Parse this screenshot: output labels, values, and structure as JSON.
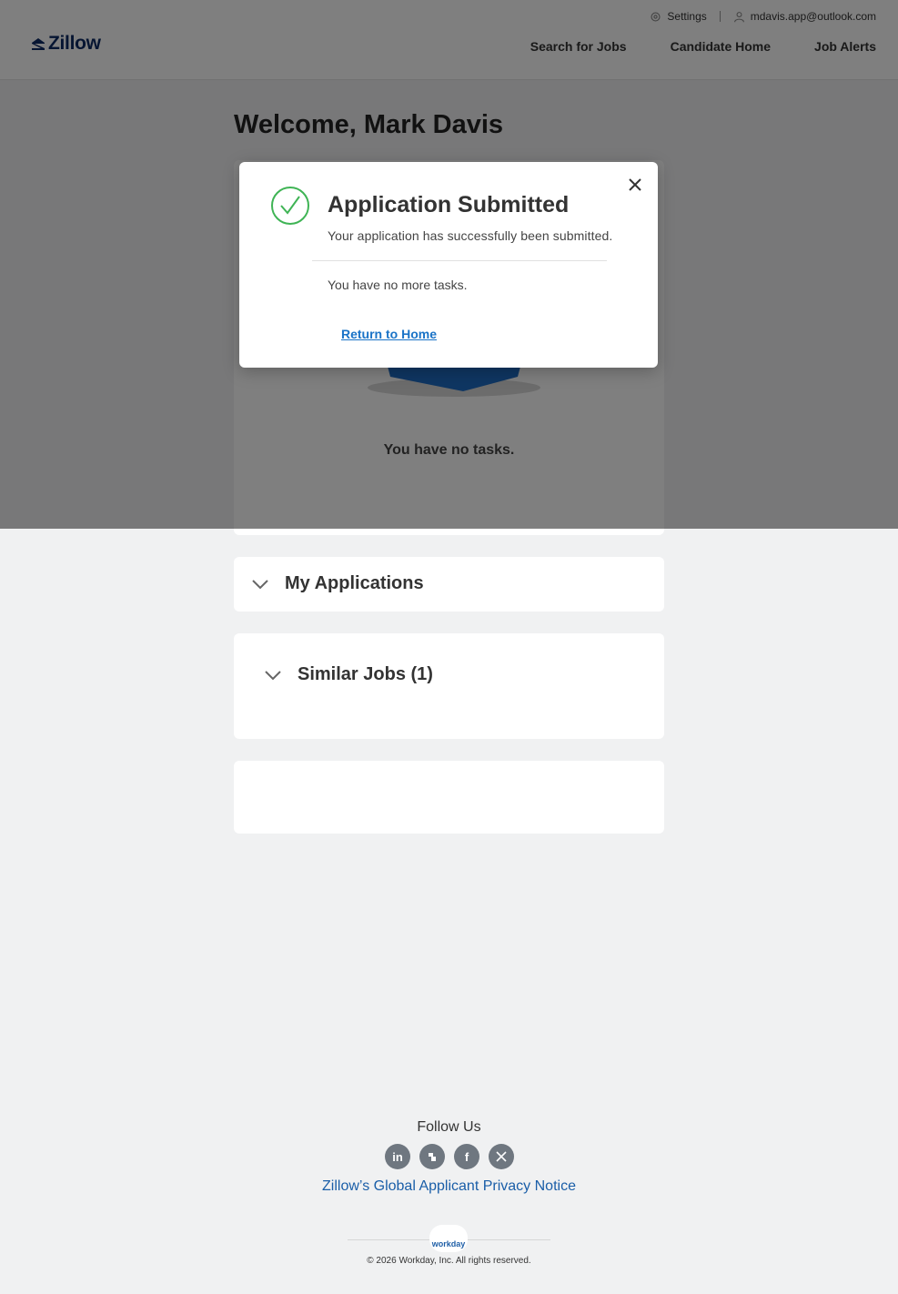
{
  "header": {
    "logo_text": "Zillow",
    "settings_label": "Settings",
    "user_email": "mdavis.app@outlook.com",
    "nav": [
      "Search for Jobs",
      "Candidate Home",
      "Job Alerts"
    ]
  },
  "main": {
    "welcome": "Welcome, Mark Davis",
    "tasks_empty": "You have no tasks.",
    "my_applications": "My Applications",
    "similar_jobs": "Similar Jobs (1)"
  },
  "modal": {
    "title": "Application Submitted",
    "subtitle": "Your application has successfully been submitted.",
    "tasks_text": "You have no more tasks.",
    "return_link": "Return to Home"
  },
  "footer": {
    "follow_us": "Follow Us",
    "socials": [
      "linkedin-icon",
      "glassdoor-icon",
      "facebook-icon",
      "x-icon"
    ],
    "privacy": "Zillow’s Global Applicant Privacy Notice",
    "workday_logo_text": "workday",
    "copyright": "© 2026 Workday, Inc. All rights reserved."
  },
  "colors": {
    "brand": "#0d2a64",
    "link": "#1a73c7",
    "success": "#3fb455"
  }
}
